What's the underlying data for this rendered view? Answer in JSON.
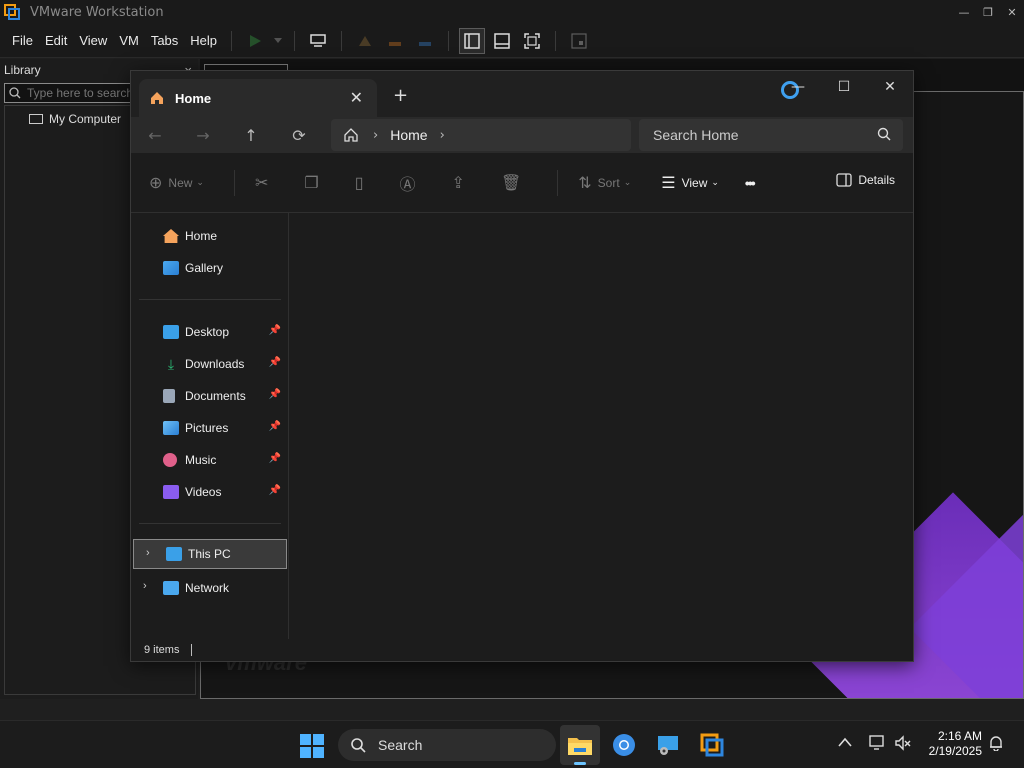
{
  "app": {
    "title": "VMware Workstation"
  },
  "menubar": {
    "items": [
      "File",
      "Edit",
      "View",
      "VM",
      "Tabs",
      "Help"
    ]
  },
  "library": {
    "title": "Library",
    "close_glyph": "×",
    "search_placeholder": "Type here to search",
    "tree": [
      {
        "label": "My Computer"
      }
    ]
  },
  "vm": {
    "watermark": "vmware"
  },
  "explorer": {
    "tab": {
      "title": "Home"
    },
    "address": {
      "crumbs": [
        "Home"
      ]
    },
    "search": {
      "placeholder": "Search Home"
    },
    "commands": {
      "new": "New",
      "sort": "Sort",
      "view": "View",
      "more": "•••",
      "details": "Details"
    },
    "sidebar": {
      "top": [
        {
          "label": "Home",
          "icon": "home-icon"
        },
        {
          "label": "Gallery",
          "icon": "gallery-icon"
        }
      ],
      "pinned": [
        {
          "label": "Desktop",
          "icon": "desktop-folder-icon",
          "color": "#3aa0e8"
        },
        {
          "label": "Downloads",
          "icon": "downloads-icon",
          "color": "#2bb673"
        },
        {
          "label": "Documents",
          "icon": "documents-icon",
          "color": "#9aa7b8"
        },
        {
          "label": "Pictures",
          "icon": "pictures-icon",
          "color": "#3aa0e8"
        },
        {
          "label": "Music",
          "icon": "music-icon",
          "color": "#e0608a"
        },
        {
          "label": "Videos",
          "icon": "videos-icon",
          "color": "#8a5cf0"
        }
      ],
      "bottom": [
        {
          "label": "This PC",
          "icon": "computer-icon"
        },
        {
          "label": "Network",
          "icon": "network-icon"
        }
      ]
    },
    "status": {
      "items": "9 items"
    }
  },
  "taskbar": {
    "search_label": "Search",
    "time": "2:16 AM",
    "date": "2/19/2025"
  }
}
